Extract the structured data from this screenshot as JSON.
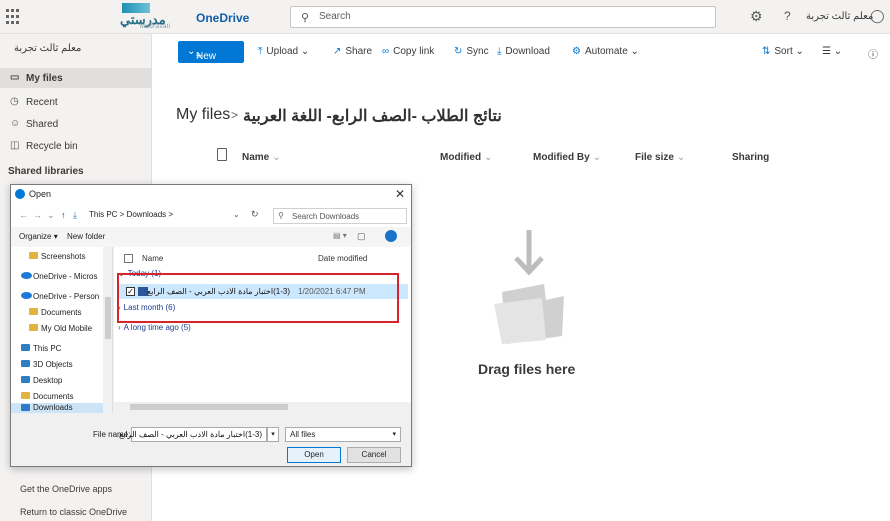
{
  "topbar": {
    "logo_text_ar": "مدرستي",
    "logo_text_en": "Madrasati",
    "app_name": "OneDrive",
    "search_placeholder": "Search",
    "user_name": "معلم ثالث تجربة"
  },
  "sidebar": {
    "user": "معلم ثالث تجربة",
    "items": [
      {
        "label": "My files"
      },
      {
        "label": "Recent"
      },
      {
        "label": "Shared"
      },
      {
        "label": "Recycle bin"
      }
    ],
    "section_title": "Shared libraries",
    "get_apps": "Get the OneDrive apps",
    "return_classic": "Return to classic OneDrive"
  },
  "commands": {
    "new": "New",
    "upload": "Upload",
    "share": "Share",
    "copy_link": "Copy link",
    "sync": "Sync",
    "download": "Download",
    "automate": "Automate",
    "sort": "Sort"
  },
  "breadcrumb": {
    "root": "My files",
    "separator": ">",
    "folder": "نتائج الطلاب -الصف الرابع- اللغة العربية"
  },
  "columns": {
    "name": "Name",
    "modified": "Modified",
    "modified_by": "Modified By",
    "file_size": "File size",
    "sharing": "Sharing"
  },
  "empty_state": {
    "drag_text": "Drag files here"
  },
  "dialog": {
    "title": "Open",
    "path": "This PC  >  Downloads  >",
    "search_placeholder": "Search Downloads",
    "organize": "Organize",
    "new_folder": "New folder",
    "tree": [
      {
        "label": "Screenshots",
        "icon": "folder"
      },
      {
        "label": "OneDrive - Micros",
        "icon": "cloud"
      },
      {
        "label": "OneDrive - Person",
        "icon": "cloud"
      },
      {
        "label": "Documents",
        "icon": "folder"
      },
      {
        "label": "My Old Mobile",
        "icon": "folder"
      },
      {
        "label": "This PC",
        "icon": "pc"
      },
      {
        "label": "3D Objects",
        "icon": "pc"
      },
      {
        "label": "Desktop",
        "icon": "pc"
      },
      {
        "label": "Documents",
        "icon": "folder"
      },
      {
        "label": "Downloads",
        "icon": "download"
      }
    ],
    "header_name": "Name",
    "header_date": "Date modified",
    "groups": {
      "today": "Today (1)",
      "last_month": "Last month (6)",
      "long_ago": "A long time ago (5)"
    },
    "file": {
      "name": "(1-3)اختبار مادة الادب العربي - الصف الرابع",
      "date": "1/20/2021 6:47 PM",
      "checked": "✓"
    },
    "file_name_label": "File name:",
    "file_name_value": "(1-3)اختبار مادة الادب العربي - الصف الرابع",
    "file_type": "All files",
    "open": "Open",
    "cancel": "Cancel"
  }
}
